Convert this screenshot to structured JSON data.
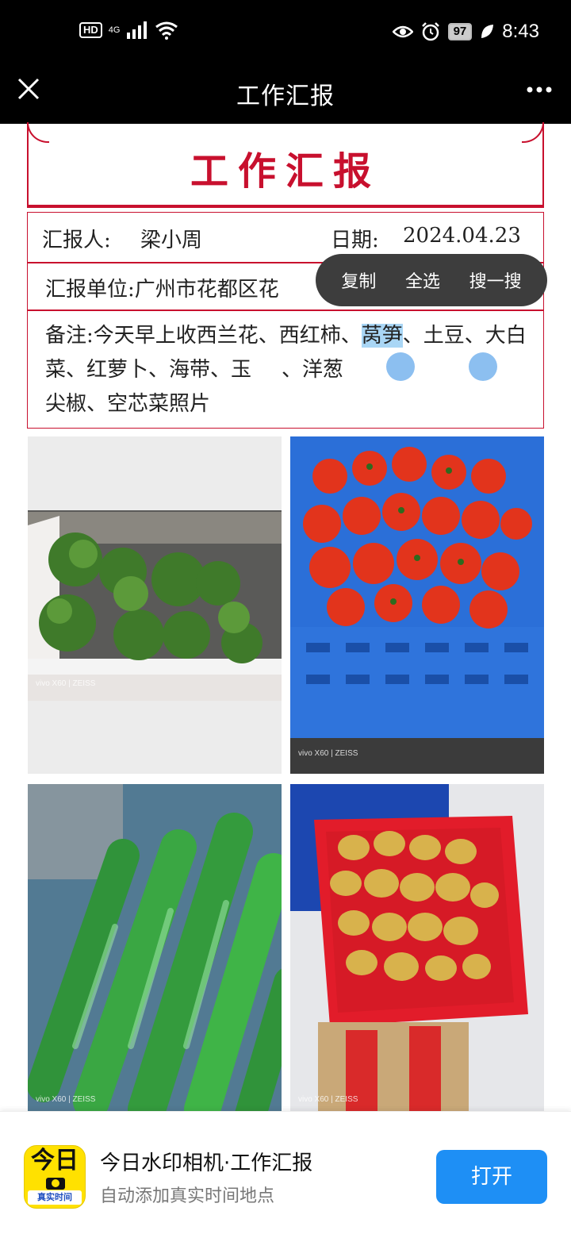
{
  "status_bar": {
    "hd": "HD",
    "network": "4G",
    "battery": "97",
    "time": "8:43",
    "icons": [
      "signal-icon",
      "wifi-icon",
      "eye-icon",
      "alarm-icon",
      "battery-icon",
      "leaf-icon"
    ]
  },
  "navbar": {
    "title": "工作汇报",
    "close_icon": "close-icon",
    "more_icon": "more-icon"
  },
  "report": {
    "title": "工作汇报",
    "reporter_label": "汇报人:",
    "reporter_name": "梁小周",
    "date_label": "日期:",
    "date_value": "2024.04.23",
    "unit_text": "汇报单位:广州市花都区花",
    "note_before": "备注:今天早上收西兰花、西红柿、",
    "note_selected": "莴笋",
    "note_after": "、土豆、大白菜、红萝卜、海带、玉",
    "note_after2": "、洋葱",
    "note_end": "尖椒、空芯菜照片"
  },
  "context_menu": {
    "items": [
      "复制",
      "全选",
      "搜一搜"
    ]
  },
  "photos": [
    {
      "subject": "broccoli",
      "watermark": "vivo X60 | ZEISS"
    },
    {
      "subject": "tomatoes",
      "watermark": "vivo X60 | ZEISS"
    },
    {
      "subject": "lettuce stems",
      "watermark": "vivo X60 | ZEISS"
    },
    {
      "subject": "potatoes",
      "watermark": "vivo X60 | ZEISS"
    }
  ],
  "banner": {
    "icon_top": "今日",
    "icon_bottom": "真实时间",
    "app_title": "今日水印相机·工作汇报",
    "app_subtitle": "自动添加真实时间地点",
    "open_button": "打开"
  },
  "colors": {
    "accent_red": "#c8102e",
    "selection": "#a9d6f5",
    "open_button": "#1e8ff5",
    "icon_yellow": "#ffe100"
  }
}
